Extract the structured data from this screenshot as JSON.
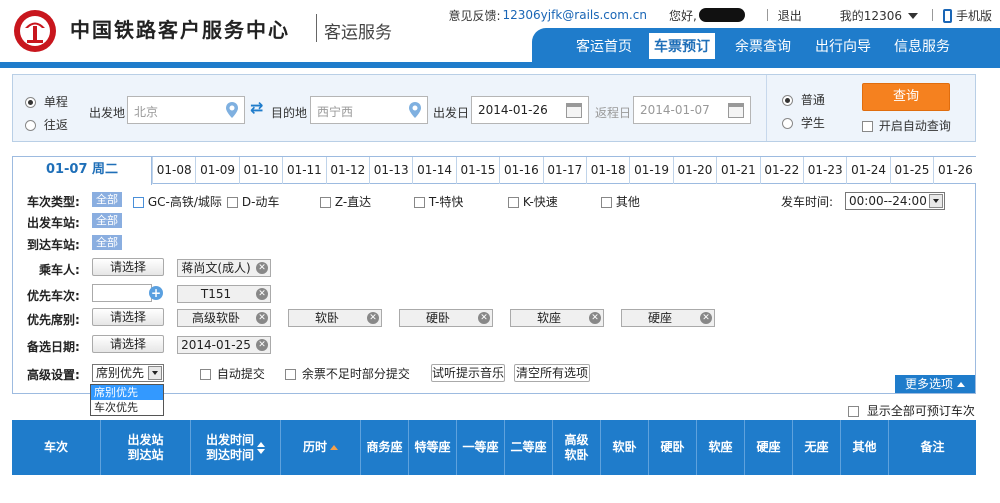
{
  "header": {
    "brand": "中国铁路客户服务中心",
    "sub_brand": "客运服务",
    "feedback_label": "意见反馈:",
    "feedback_email": "12306yjfk@rails.com.cn",
    "greeting": "您好,",
    "logout": "退出",
    "my_account": "我的12306",
    "mobile": "手机版"
  },
  "nav": {
    "items": [
      "客运首页",
      "车票预订",
      "余票查询",
      "出行向导",
      "信息服务"
    ],
    "active_index": 1
  },
  "search": {
    "trip_types": [
      "单程",
      "往返"
    ],
    "trip_selected": "单程",
    "from_label": "出发地",
    "from_value": "北京",
    "to_label": "目的地",
    "to_value": "西宁西",
    "depart_label": "出发日",
    "depart_value": "2014-01-26",
    "return_label": "返程日",
    "return_value": "2014-01-07",
    "passenger_types": [
      "普通",
      "学生"
    ],
    "passenger_selected": "普通",
    "query_button": "查询",
    "auto_query": "开启自动查询"
  },
  "date_tabs": {
    "active": "01-07 周二",
    "dates": [
      "01-08",
      "01-09",
      "01-10",
      "01-11",
      "01-12",
      "01-13",
      "01-14",
      "01-15",
      "01-16",
      "01-17",
      "01-18",
      "01-19",
      "01-20",
      "01-21",
      "01-22",
      "01-23",
      "01-24",
      "01-25",
      "01-26"
    ]
  },
  "filters": {
    "train_type_label": "车次类型:",
    "all": "全部",
    "train_types": [
      "GC-高铁/城际",
      "D-动车",
      "Z-直达",
      "T-特快",
      "K-快速",
      "其他"
    ],
    "depart_time_label": "发车时间:",
    "depart_time_value": "00:00--24:00",
    "from_station_label": "出发车站:",
    "to_station_label": "到达车站:",
    "passenger_label": "乘车人:",
    "choose": "请选择",
    "passenger_chip": "蒋尚文(成人)",
    "priority_train_label": "优先车次:",
    "priority_train_chip": "T151",
    "priority_seat_label": "优先席别:",
    "seat_chips": [
      "高级软卧",
      "软卧",
      "硬卧",
      "软座",
      "硬座"
    ],
    "backup_date_label": "备选日期:",
    "backup_date_chip": "2014-01-25",
    "advanced_label": "高级设置:",
    "advanced_select_value": "席别优先",
    "advanced_options": [
      "席别优先",
      "车次优先"
    ],
    "auto_submit": "自动提交",
    "partial_submit": "余票不足时部分提交",
    "music_button": "试听提示音乐",
    "clear_button": "清空所有选项",
    "more_options": "更多选项"
  },
  "table": {
    "show_all": "显示全部可预订车次",
    "headers": {
      "train": "车次",
      "stations_1": "出发站",
      "stations_2": "到达站",
      "times_1": "出发时间",
      "times_2": "到达时间",
      "duration": "历时",
      "business": "商务座",
      "special": "特等座",
      "first": "一等座",
      "second": "二等座",
      "adv_soft_1": "高级",
      "adv_soft_2": "软卧",
      "soft_sleeper": "软卧",
      "hard_sleeper": "硬卧",
      "soft_seat": "软座",
      "hard_seat": "硬座",
      "no_seat": "无座",
      "other": "其他",
      "note": "备注"
    }
  },
  "colors": {
    "brand_blue": "#1f7ccb",
    "query_orange": "#f5811f",
    "logo_red": "#c8161d"
  }
}
